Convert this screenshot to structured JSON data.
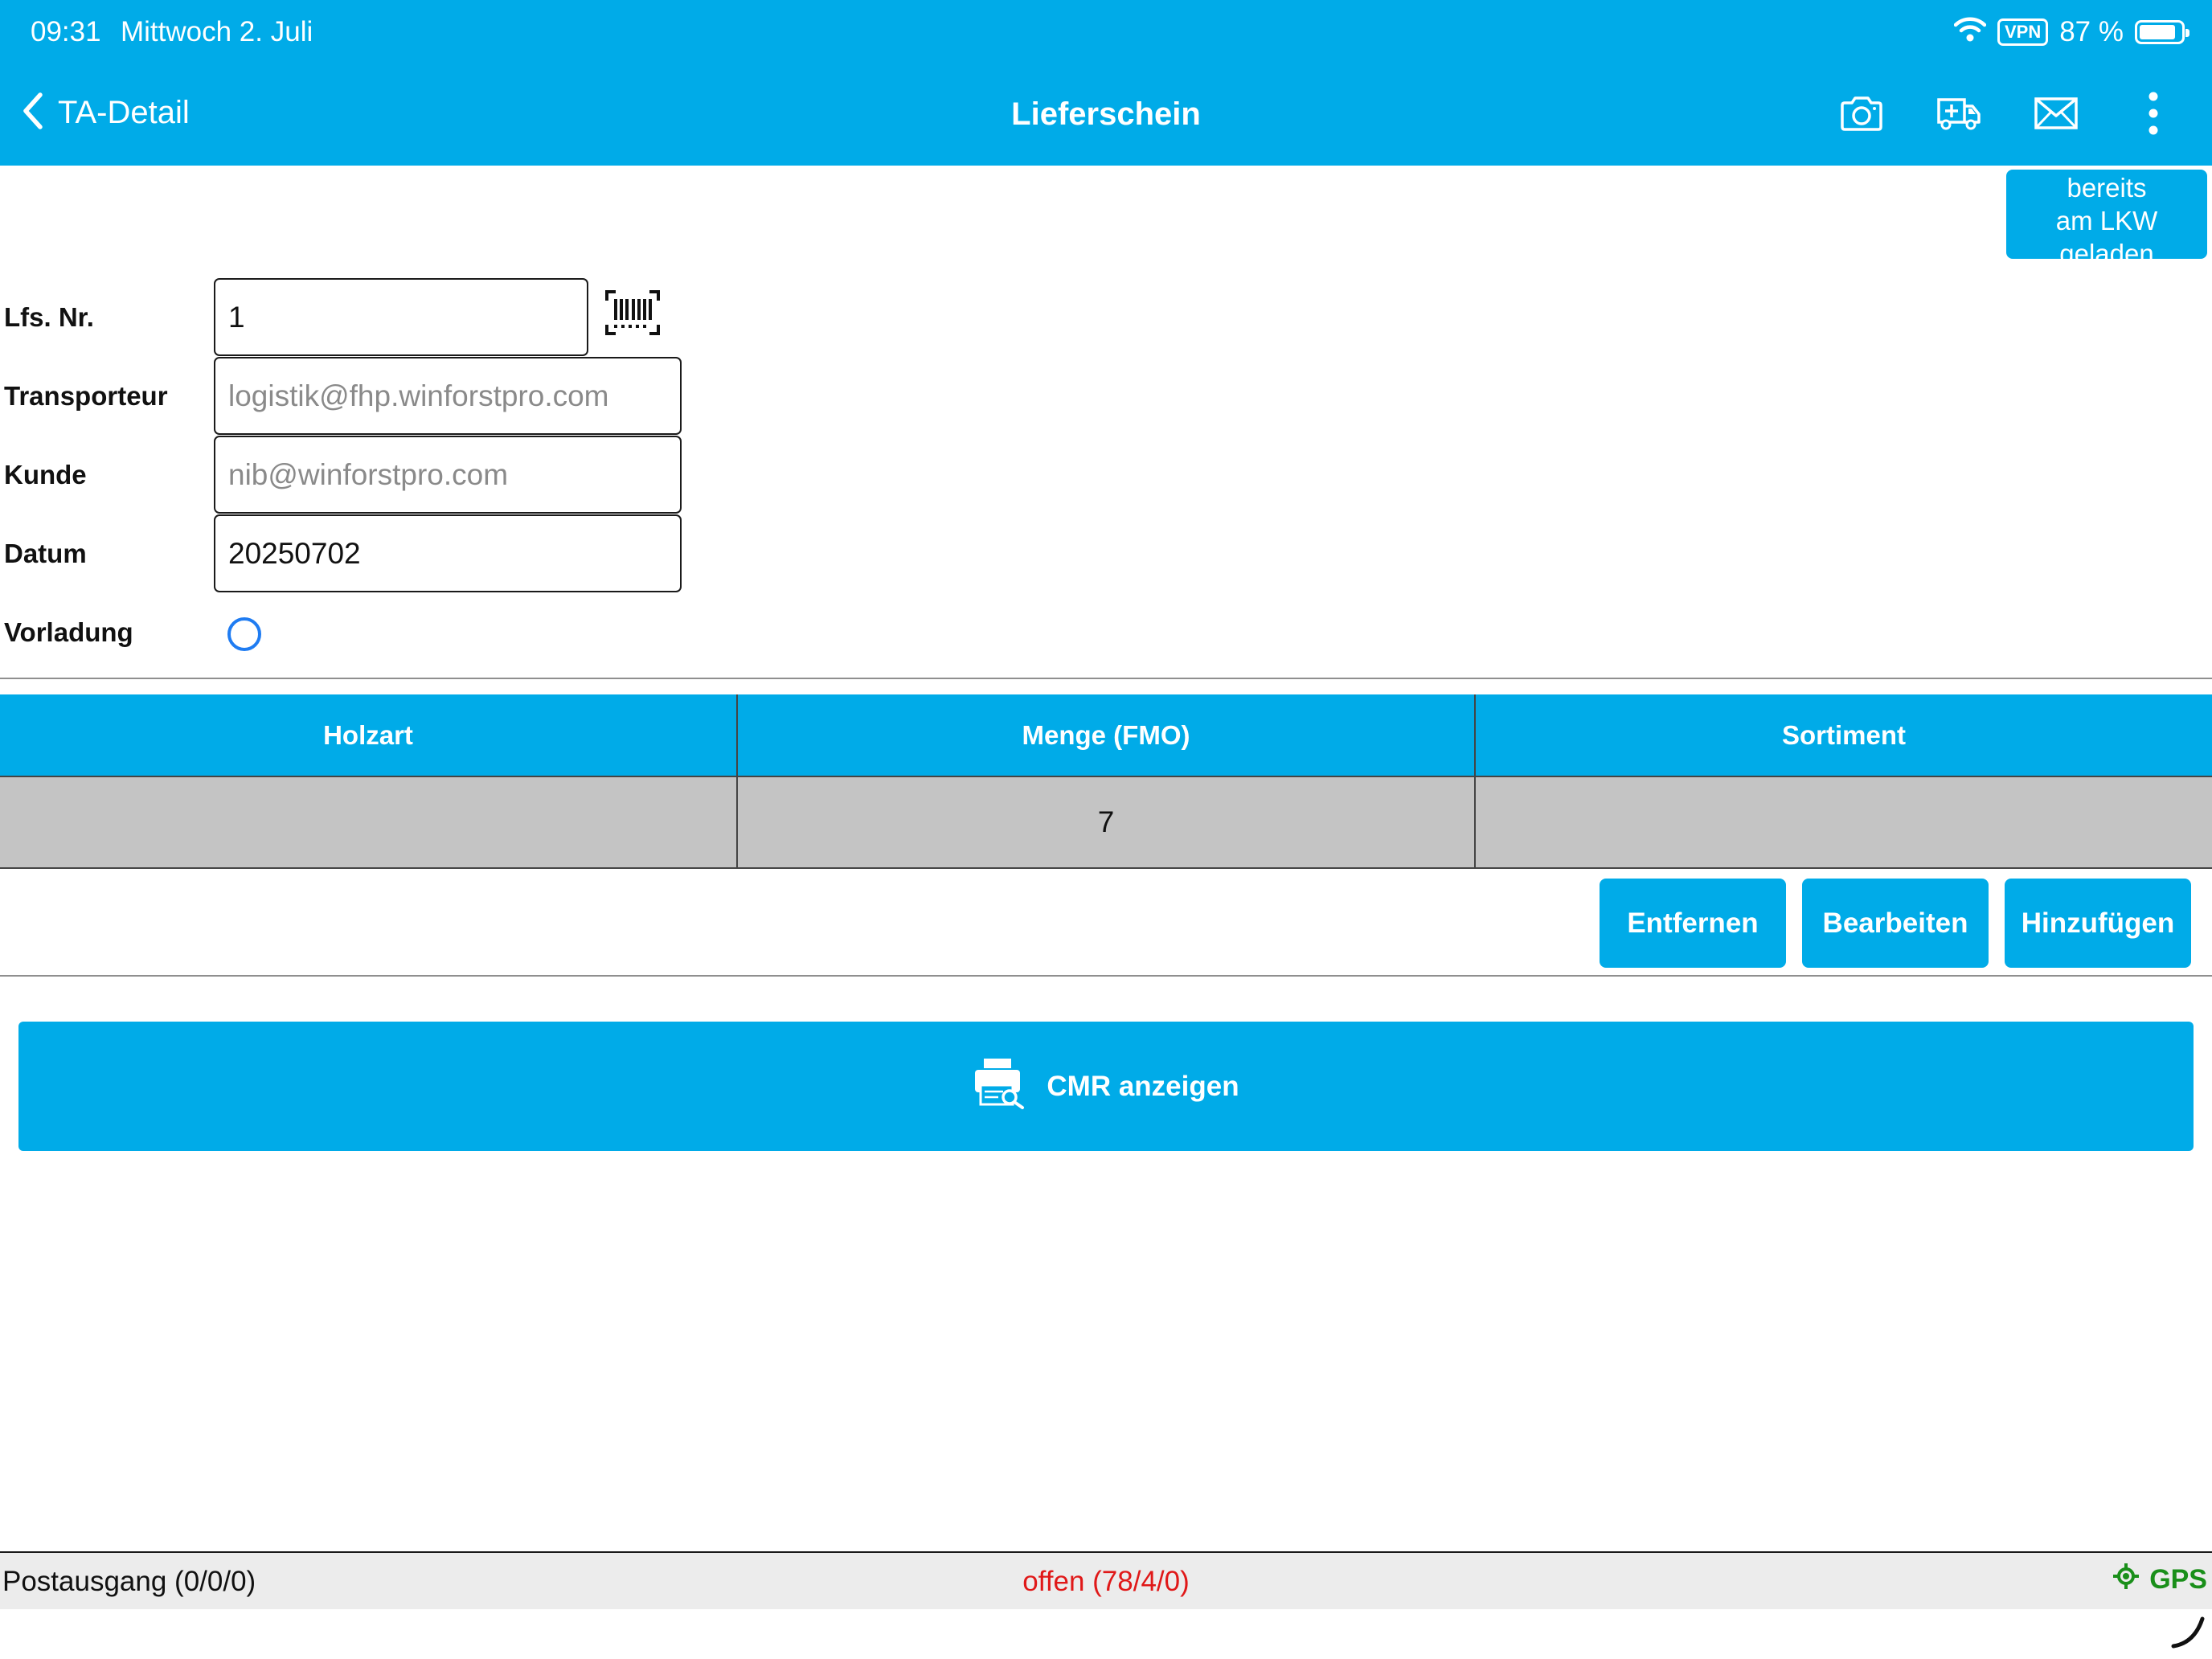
{
  "status_bar": {
    "time": "09:31",
    "date": "Mittwoch 2. Juli",
    "vpn": "VPN",
    "battery": "87 %",
    "battery_level": 0.87
  },
  "nav": {
    "back_label": "TA-Detail",
    "title": "Lieferschein",
    "icons": [
      "camera-icon",
      "truck-add-icon",
      "mail-icon",
      "more-vertical-icon"
    ]
  },
  "loaded_button": {
    "line1": "bereits",
    "line2": "am LKW",
    "line3": "geladen"
  },
  "form": {
    "lfs_label": "Lfs. Nr.",
    "lfs_value": "1",
    "transporteur_label": "Transporteur",
    "transporteur_placeholder": "logistik@fhp.winforstpro.com",
    "kunde_label": "Kunde",
    "kunde_placeholder": "nib@winforstpro.com",
    "datum_label": "Datum",
    "datum_value": "20250702",
    "vorladung_label": "Vorladung",
    "vorladung_checked": false
  },
  "table": {
    "columns": [
      "Holzart",
      "Menge (FMO)",
      "Sortiment"
    ],
    "rows": [
      [
        "",
        "7",
        ""
      ]
    ]
  },
  "actions": {
    "remove": "Entfernen",
    "edit": "Bearbeiten",
    "add": "Hinzufügen"
  },
  "cmr": {
    "label": "CMR anzeigen",
    "icon": "printer-search-icon"
  },
  "footer": {
    "outbox": "Postausgang (0/0/0)",
    "open": "offen (78/4/0)",
    "gps": "GPS"
  },
  "colors": {
    "primary": "#00abe8",
    "open_status": "#e01818",
    "gps": "#1a8f1a",
    "radio": "#1f7cf2",
    "row_bg": "#c4c4c4"
  }
}
